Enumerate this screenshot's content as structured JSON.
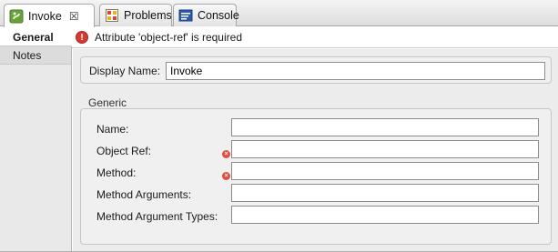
{
  "tabs": [
    {
      "label": "Invoke",
      "icon": "bean-icon",
      "active": true,
      "close": "☒"
    },
    {
      "label": "Problems",
      "icon": "problems-icon",
      "active": false
    },
    {
      "label": "Console",
      "icon": "console-icon",
      "active": false
    }
  ],
  "error": {
    "message": "Attribute 'object-ref' is required",
    "icon": "error-icon"
  },
  "sidetabs": [
    {
      "label": "General",
      "active": true
    },
    {
      "label": "Notes",
      "active": false
    }
  ],
  "general": {
    "display_name_label": "Display Name:",
    "display_name_value": "Invoke"
  },
  "generic": {
    "title": "Generic",
    "fields": [
      {
        "label": "Name:",
        "value": "",
        "required": false
      },
      {
        "label": "Object Ref:",
        "value": "",
        "required": true
      },
      {
        "label": "Method:",
        "value": "",
        "required": true
      },
      {
        "label": "Method Arguments:",
        "value": "",
        "required": false
      },
      {
        "label": "Method Argument Types:",
        "value": "",
        "required": false
      }
    ]
  },
  "colors": {
    "error": "#d23a34",
    "tab_border": "#a9a9a9"
  }
}
